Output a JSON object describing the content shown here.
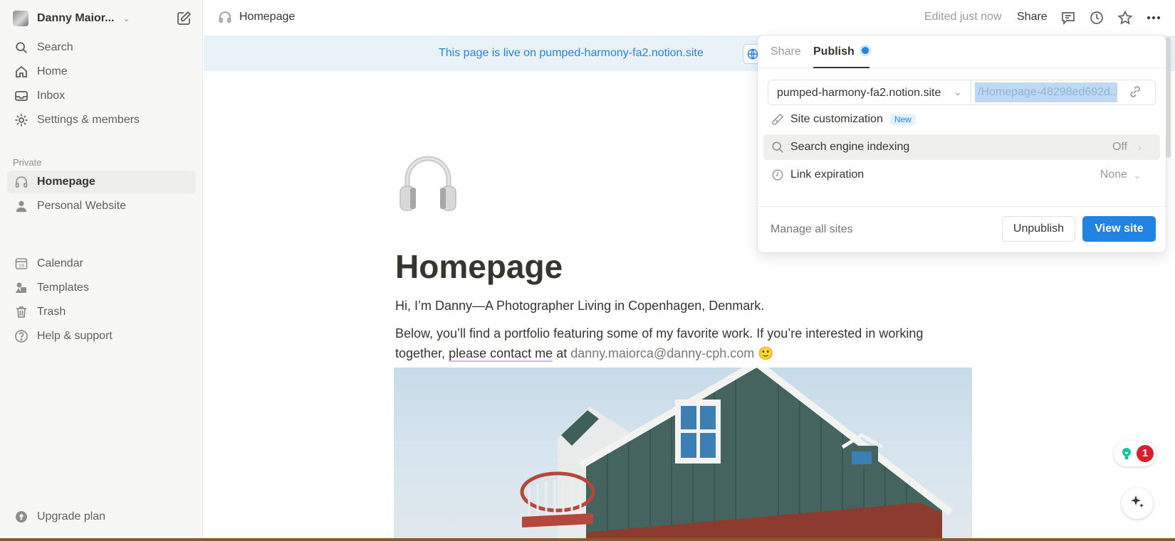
{
  "sidebar": {
    "workspace_name": "Danny Maior...",
    "nav": {
      "search": "Search",
      "home": "Home",
      "inbox": "Inbox",
      "settings": "Settings & members"
    },
    "section_label": "Private",
    "pages": {
      "homepage": "Homepage",
      "personal_website": "Personal Website"
    },
    "tools": {
      "calendar": "Calendar",
      "templates": "Templates",
      "trash": "Trash",
      "help": "Help & support"
    },
    "upgrade": "Upgrade plan"
  },
  "topbar": {
    "breadcrumb": "Homepage",
    "edited": "Edited just now",
    "share": "Share"
  },
  "banner": {
    "text": "This page is live on pumped-harmony-fa2.notion.site"
  },
  "page": {
    "title": "Homepage",
    "intro": "Hi, I’m Danny—A Photographer Living in Copenhagen, Denmark.",
    "body_before": "Below, you’ll find a portfolio featuring some of my favorite work. If you’re interested in working together,",
    "link_text": "please contact me",
    "at": "at",
    "email": "danny.maiorca@danny-cph.com",
    "emoji": "🙂"
  },
  "publish_popover": {
    "tabs": [
      "Share",
      "Publish"
    ],
    "active_tab": "Publish",
    "domain": "pumped-harmony-fa2.notion.site",
    "slug": "/Homepage-48298ed692d...",
    "site_customization": "Site customization",
    "new_badge": "New",
    "search_indexing": "Search engine indexing",
    "search_indexing_value": "Off",
    "link_expiration": "Link expiration",
    "link_expiration_value": "None",
    "manage_sites": "Manage all sites",
    "unpublish": "Unpublish",
    "view_site": "View site"
  },
  "notifications": {
    "count": "1"
  },
  "colors": {
    "accent": "#2383e2",
    "sidebar_bg": "#f7f7f5",
    "banner_bg": "#e9f2f9",
    "badge_red": "#d4212b"
  }
}
